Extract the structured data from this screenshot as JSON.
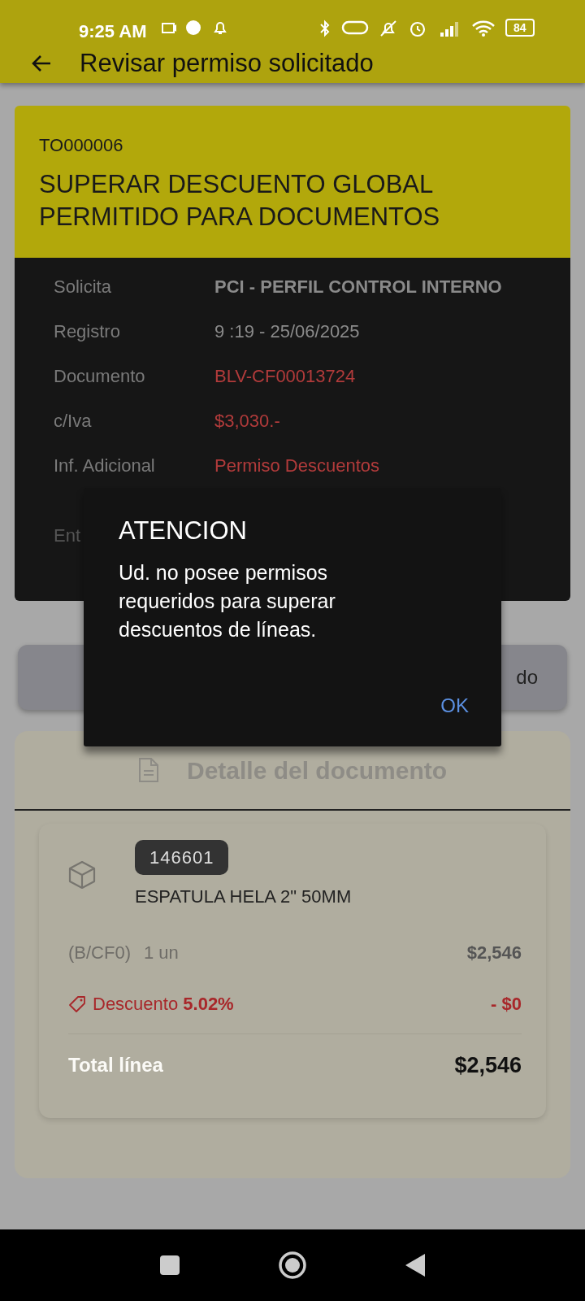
{
  "status_bar": {
    "time": "9:25 AM",
    "battery": "84"
  },
  "app_bar": {
    "title": "Revisar permiso solicitado"
  },
  "permit": {
    "code": "TO000006",
    "title": "SUPERAR DESCUENTO GLOBAL PERMITIDO PARA DOCUMENTOS",
    "fields": [
      {
        "label": "Solicita",
        "value": "PCI - PERFIL CONTROL INTERNO",
        "kind": "bold"
      },
      {
        "label": "Registro",
        "value": "9 :19 - 25/06/2025",
        "kind": "plain"
      },
      {
        "label": "Documento",
        "value": "BLV-CF00013724",
        "kind": "highlight"
      },
      {
        "label": "c/Iva",
        "value": "$3,030.-",
        "kind": "highlight"
      },
      {
        "label": "Inf. Adicional",
        "value": "Permiso Descuentos",
        "kind": "highlight"
      }
    ],
    "partial_label": "Ent"
  },
  "action_button": {
    "label": "do"
  },
  "dialog": {
    "title": "ATENCION",
    "message": "Ud. no posee permisos requeridos para superar descuentos de líneas.",
    "button": "OK"
  },
  "detail": {
    "title": "Detalle del documento",
    "item": {
      "code": "146601",
      "name": "ESPATULA HELA 2\" 50MM",
      "price_list": "(B/CF0)",
      "quantity": "1 un",
      "price": "$2,546",
      "discount_label": "Descuento **5.02%**",
      "discount_amount": "- $0",
      "total_label": "Total línea",
      "total": "$2,546"
    }
  }
}
